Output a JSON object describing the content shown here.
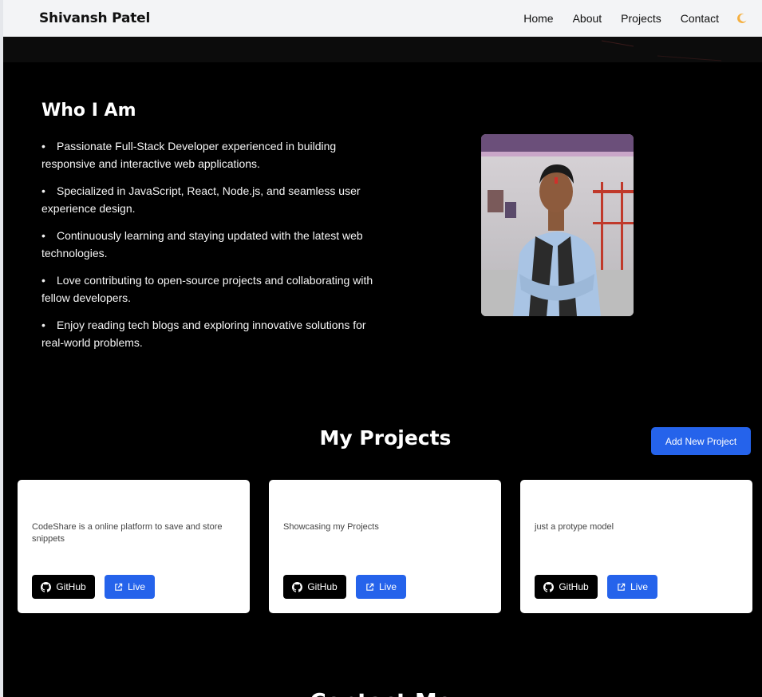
{
  "nav": {
    "brand": "Shivansh Patel",
    "links": [
      "Home",
      "About",
      "Projects",
      "Contact"
    ],
    "theme_icon": "moon-icon"
  },
  "about": {
    "title": "Who I Am",
    "items": [
      "Passionate Full-Stack Developer experienced in building responsive and interactive web applications.",
      "Specialized in JavaScript, React, Node.js, and seamless user experience design.",
      "Continuously learning and staying updated with the latest web technologies.",
      "Love contributing to open-source projects and collaborating with fellow developers.",
      "Enjoy reading tech blogs and exploring innovative solutions for real-world problems."
    ]
  },
  "projects": {
    "title": "My Projects",
    "add_label": "Add New Project",
    "cards": [
      {
        "description": "CodeShare is a online platform to save and store snippets",
        "github_label": "GitHub",
        "live_label": "Live"
      },
      {
        "description": "Showcasing my Projects",
        "github_label": "GitHub",
        "live_label": "Live"
      },
      {
        "description": "just a protype model",
        "github_label": "GitHub",
        "live_label": "Live"
      }
    ]
  },
  "contact": {
    "title": "Contact Me"
  },
  "colors": {
    "accent": "#2563eb",
    "nav_bg": "#f3f4f6",
    "page_bg": "#000000",
    "card_bg": "#ffffff",
    "moon": "#f5b041"
  }
}
